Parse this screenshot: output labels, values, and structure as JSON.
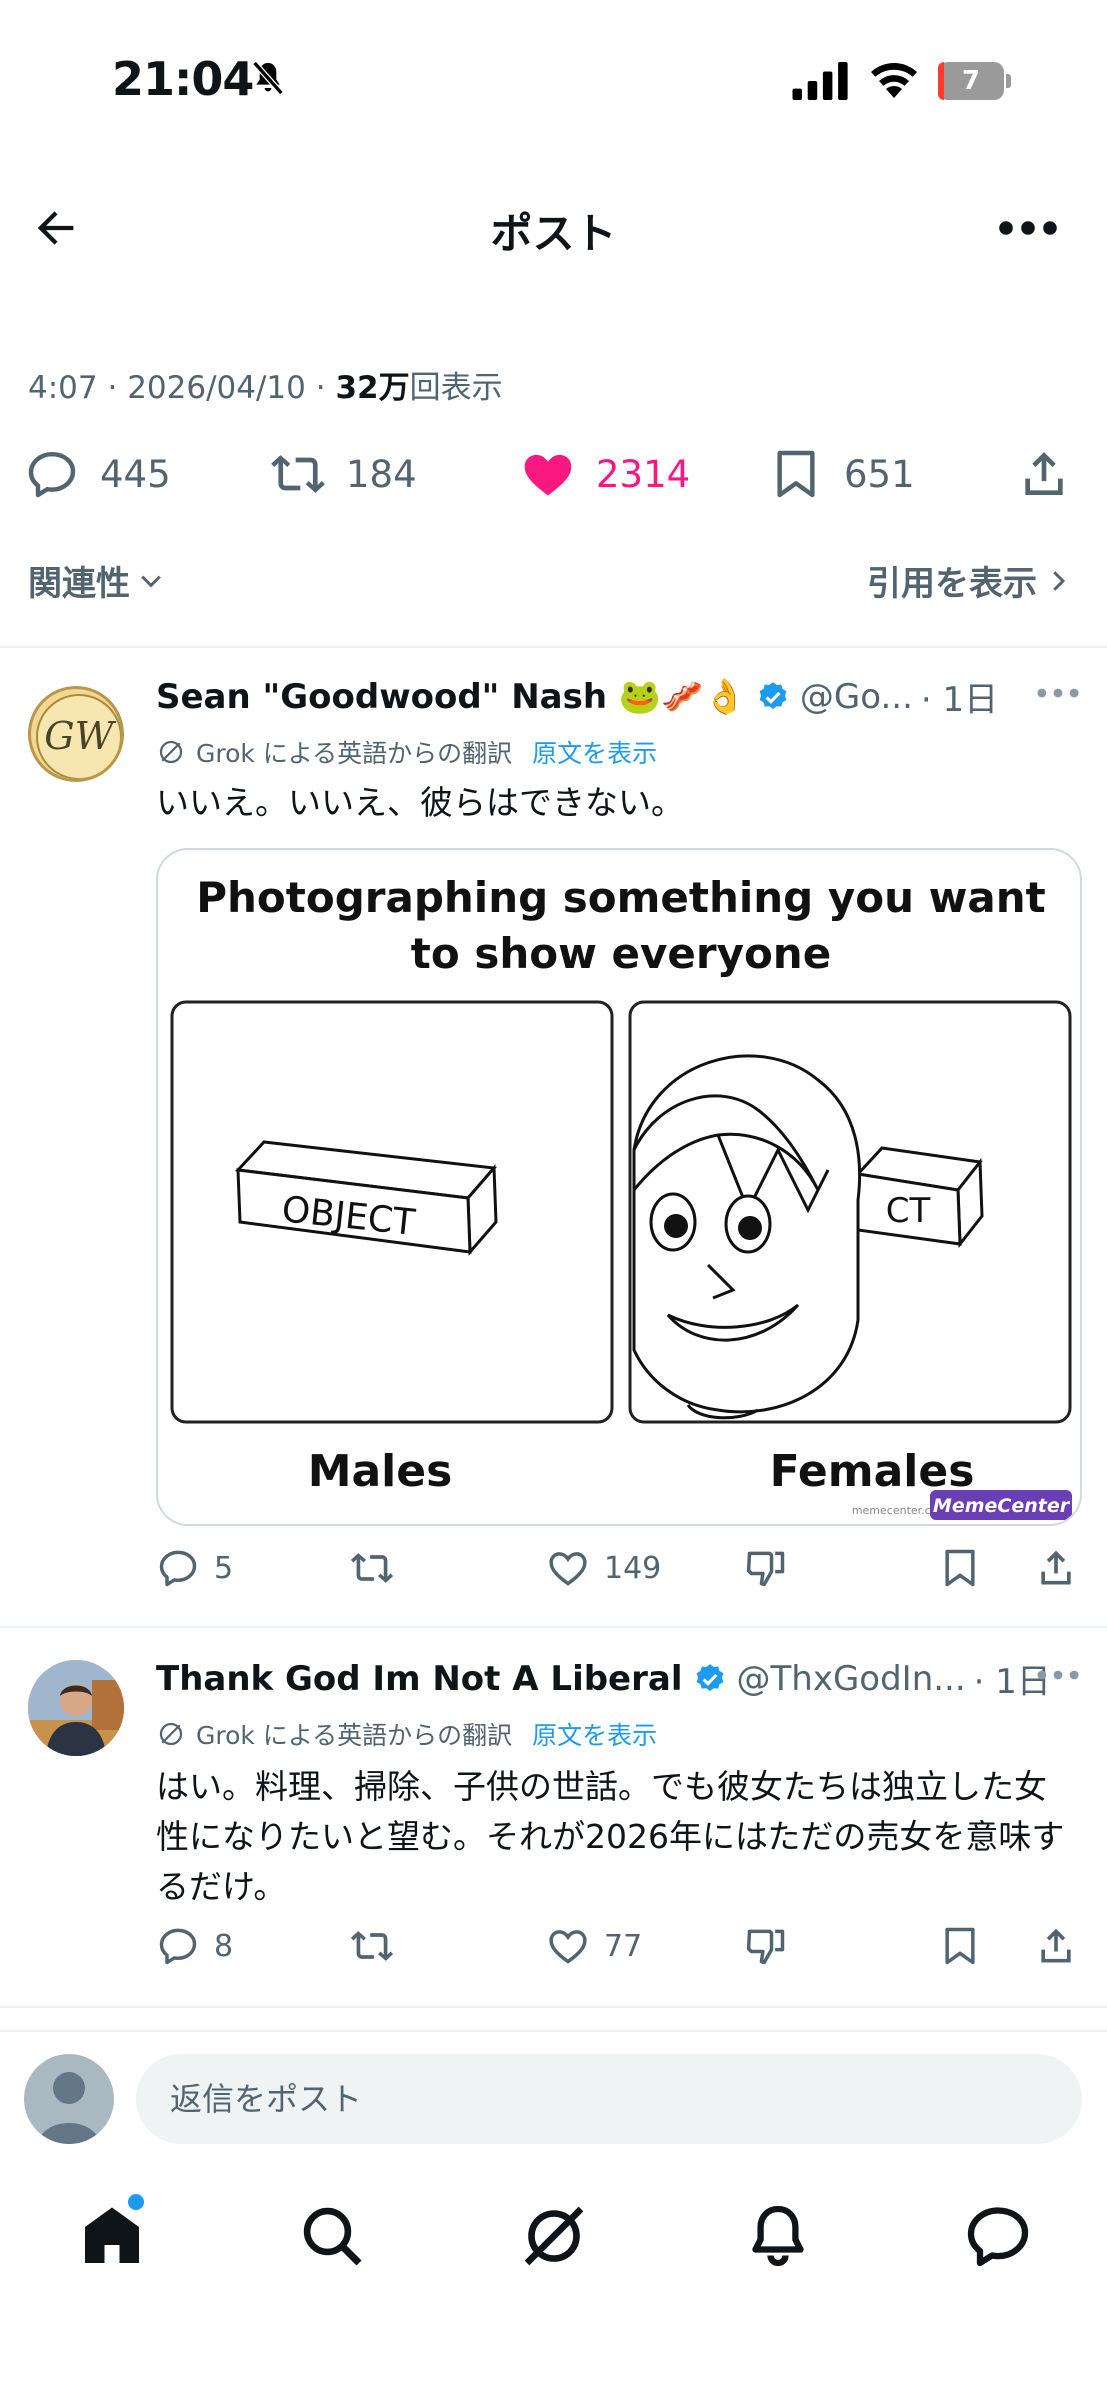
{
  "status_bar": {
    "time": "21:04",
    "battery": "7"
  },
  "header": {
    "title": "ポスト"
  },
  "post": {
    "time": "4:07",
    "date": "2026/04/10",
    "sep": "·",
    "views_count": "32万",
    "views_label": "回表示"
  },
  "engagement": {
    "replies": "445",
    "reposts": "184",
    "likes": "2314",
    "bookmarks": "651"
  },
  "sort": {
    "relevance": "関連性",
    "view_quotes": "引用を表示"
  },
  "replies": [
    {
      "author": "Sean \"Goodwood\" Nash 🐸🥓👌",
      "avatar_initials": "GW",
      "handle": "@Go...",
      "time": "· 1日",
      "translation_note": "Grok による英語からの翻訳",
      "show_original": "原文を表示",
      "text": "いいえ。いいえ、彼らはできない。",
      "image": {
        "title_line1": "Photographing something you want",
        "title_line2": "to show everyone",
        "box_label": "OBJECT",
        "box_label_partial": "CT",
        "label_left": "Males",
        "label_right": "Females",
        "watermark_small": "memecenter.com",
        "watermark": "MemeCenter"
      },
      "counts": {
        "replies": "5",
        "likes": "149"
      }
    },
    {
      "author": "Thank God Im Not A Liberal",
      "handle": "@ThxGodIn...",
      "time": "· 1日",
      "translation_note": "Grok による英語からの翻訳",
      "show_original": "原文を表示",
      "text": "はい。料理、掃除、子供の世話。でも彼女たちは独立した女性になりたいと望む。それが2026年にはただの売女を意味するだけ。",
      "counts": {
        "replies": "8",
        "likes": "77"
      }
    }
  ],
  "composer": {
    "placeholder": "返信をポスト"
  },
  "colors": {
    "like": "#f91880",
    "link": "#1d9bf0",
    "muted": "#536471",
    "verified": "#1d9bf0"
  },
  "icons": [
    "bell-off-icon",
    "signal-icon",
    "wifi-icon",
    "battery-icon",
    "back-arrow-icon",
    "more-icon",
    "reply-icon",
    "repost-icon",
    "heart-icon",
    "bookmark-icon",
    "share-icon",
    "chevron-down-icon",
    "chevron-right-icon",
    "verified-icon",
    "grok-icon",
    "dislike-icon",
    "home-icon",
    "search-icon",
    "grok-nav-icon",
    "notifications-icon",
    "messages-icon"
  ]
}
